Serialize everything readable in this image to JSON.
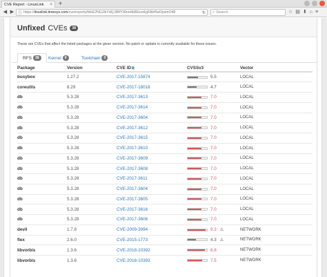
{
  "browser": {
    "tab_title": "CVE Report - LinuxLink",
    "tab_close": "×",
    "new_tab": "+",
    "url_host": "linuxlink.timesys.com",
    "url_prefix": "https://",
    "url_path": "/cve/reports/MzE2NGJlkYdQ.9BPO8nnHkBEeeKgFAbf5wDpwnO48",
    "search_placeholder": "Search"
  },
  "page": {
    "title_bold": "Unfixed",
    "title_rest": "CVEs",
    "title_count": "38",
    "description": "These are CVEs that affect the listed packages at the given version. No patch or update is currently available for these issues.",
    "tabs": [
      {
        "label": "RFS",
        "count": "38"
      },
      {
        "label": "Kernel",
        "count": "0"
      },
      {
        "label": "Toolchain",
        "count": "0"
      }
    ],
    "columns": [
      "Package",
      "Version",
      "CVE ID",
      "CVSSv3",
      "Vector"
    ]
  },
  "colors": {
    "high": "#cc5a5a",
    "medium": "#777777",
    "link": "#2a76b8"
  },
  "rows": [
    {
      "pkg": "busybox",
      "ver": "1.27.2",
      "cve": "CVE-2017-15874",
      "score": "5.5",
      "level": "medium",
      "warn": "",
      "vec": "LOCAL"
    },
    {
      "pkg": "coreutils",
      "ver": "8.29",
      "cve": "CVE-2017-18018",
      "score": "4.7",
      "level": "medium",
      "warn": "",
      "vec": "LOCAL"
    },
    {
      "pkg": "db",
      "ver": "5.3.28",
      "cve": "CVE-2017-3613",
      "score": "7.0",
      "level": "high",
      "warn": "",
      "vec": "LOCAL"
    },
    {
      "pkg": "db",
      "ver": "5.3.28",
      "cve": "CVE-2017-3614",
      "score": "7.0",
      "level": "high",
      "warn": "",
      "vec": "LOCAL"
    },
    {
      "pkg": "db",
      "ver": "5.3.28",
      "cve": "CVE-2017-3604",
      "score": "7.0",
      "level": "high",
      "warn": "",
      "vec": "LOCAL"
    },
    {
      "pkg": "db",
      "ver": "5.3.28",
      "cve": "CVE-2017-3612",
      "score": "7.0",
      "level": "high",
      "warn": "",
      "vec": "LOCAL"
    },
    {
      "pkg": "db",
      "ver": "5.3.28",
      "cve": "CVE-2017-3615",
      "score": "7.0",
      "level": "high",
      "warn": "",
      "vec": "LOCAL"
    },
    {
      "pkg": "db",
      "ver": "5.3.28",
      "cve": "CVE-2017-3610",
      "score": "7.0",
      "level": "high",
      "warn": "",
      "vec": "LOCAL"
    },
    {
      "pkg": "db",
      "ver": "5.3.28",
      "cve": "CVE-2017-3609",
      "score": "7.0",
      "level": "high",
      "warn": "",
      "vec": "LOCAL"
    },
    {
      "pkg": "db",
      "ver": "5.3.28",
      "cve": "CVE-2017-3608",
      "score": "7.0",
      "level": "high",
      "warn": "",
      "vec": "LOCAL"
    },
    {
      "pkg": "db",
      "ver": "5.3.28",
      "cve": "CVE-2017-3611",
      "score": "7.0",
      "level": "high",
      "warn": "",
      "vec": "LOCAL"
    },
    {
      "pkg": "db",
      "ver": "5.3.28",
      "cve": "CVE-2017-3604",
      "score": "7.0",
      "level": "high",
      "warn": "",
      "vec": "LOCAL"
    },
    {
      "pkg": "db",
      "ver": "5.3.28",
      "cve": "CVE-2017-3605",
      "score": "7.0",
      "level": "high",
      "warn": "",
      "vec": "LOCAL"
    },
    {
      "pkg": "db",
      "ver": "5.3.28",
      "cve": "CVE-2017-3616",
      "score": "7.0",
      "level": "high",
      "warn": "",
      "vec": "LOCAL"
    },
    {
      "pkg": "db",
      "ver": "5.3.28",
      "cve": "CVE-2017-3606",
      "score": "7.0",
      "level": "high",
      "warn": "",
      "vec": "LOCAL"
    },
    {
      "pkg": "devil",
      "ver": "1.7.8",
      "cve": "CVE-2009-3994",
      "score": "9.3",
      "level": "high",
      "warn": "⚠",
      "vec": "NETWORK"
    },
    {
      "pkg": "flex",
      "ver": "2.6.0",
      "cve": "CVE-2015-1773",
      "score": "4.3",
      "level": "medium",
      "warn": "⚠",
      "vec": "NETWORK"
    },
    {
      "pkg": "libvorbis",
      "ver": "1.3.6",
      "cve": "CVE-2018-10392",
      "score": "8.8",
      "level": "high",
      "warn": "",
      "vec": "NETWORK"
    },
    {
      "pkg": "libvorbis",
      "ver": "1.3.6",
      "cve": "CVE-2018-10393",
      "score": "7.5",
      "level": "high",
      "warn": "",
      "vec": "NETWORK"
    }
  ]
}
